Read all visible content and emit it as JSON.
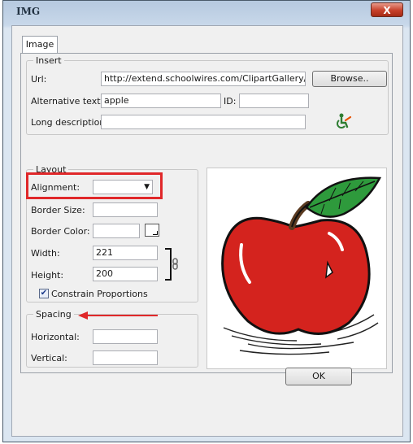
{
  "window": {
    "title": "IMG",
    "close_label": "X"
  },
  "tab": {
    "label": "Image"
  },
  "insert": {
    "legend": "Insert",
    "url_label": "Url:",
    "url_value": "http://extend.schoolwires.com/ClipartGallery/image",
    "browse_label": "Browse..",
    "alt_label": "Alternative text:",
    "alt_value": "apple",
    "id_label": "ID:",
    "id_value": "",
    "longdesc_label": "Long description:",
    "longdesc_value": ""
  },
  "layout": {
    "legend": "Layout",
    "alignment_label": "Alignment:",
    "alignment_value": "",
    "border_size_label": "Border Size:",
    "border_size_value": "",
    "border_color_label": "Border Color:",
    "border_color_value": "",
    "width_label": "Width:",
    "width_value": "221",
    "height_label": "Height:",
    "height_value": "200",
    "constrain_label": "Constrain Proportions",
    "constrain_checked": true
  },
  "spacing": {
    "legend": "Spacing",
    "horizontal_label": "Horizontal:",
    "horizontal_value": "",
    "vertical_label": "Vertical:",
    "vertical_value": ""
  },
  "ok_label": "OK",
  "colors": {
    "highlight": "#e0282a",
    "apple": "#d4231e",
    "leaf": "#2e9a3c"
  }
}
